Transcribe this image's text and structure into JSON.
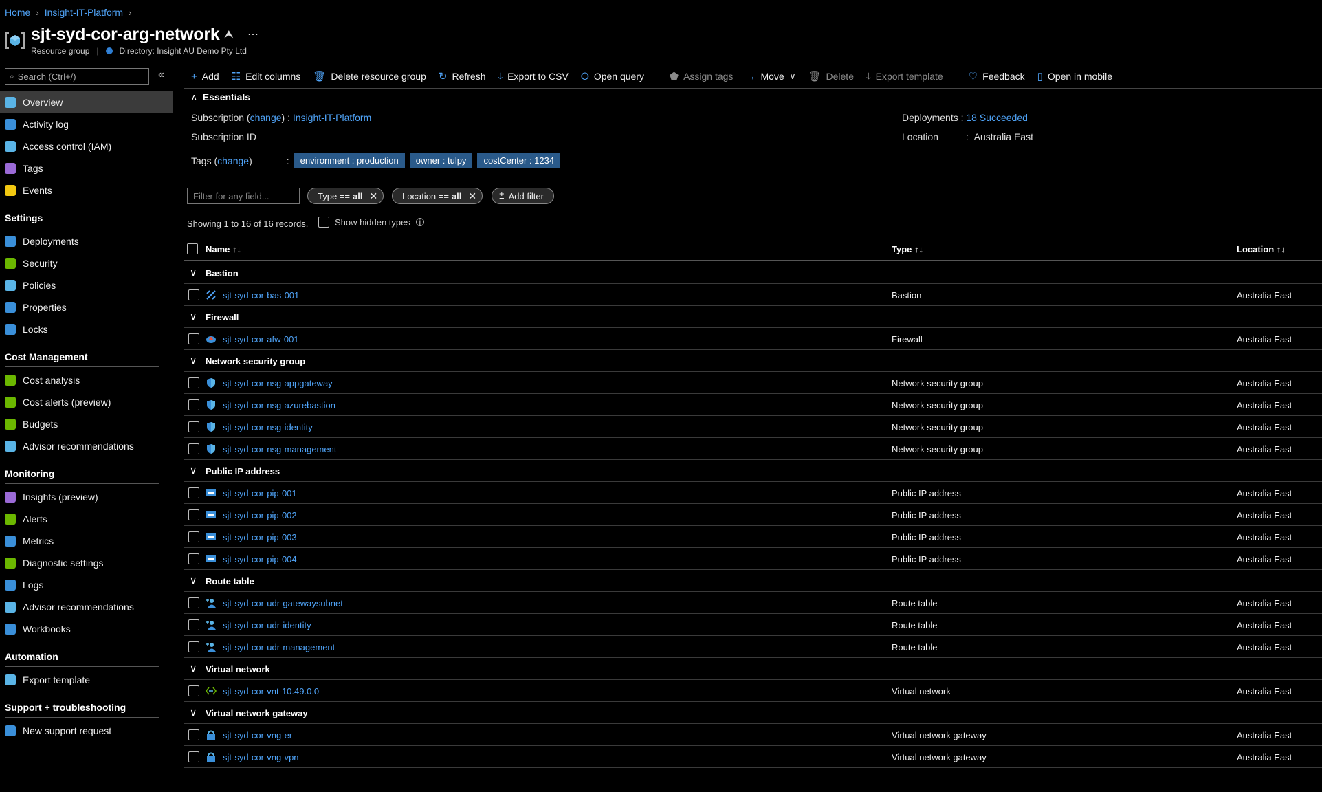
{
  "breadcrumb": {
    "home": "Home",
    "parent": "Insight-IT-Platform"
  },
  "header": {
    "title": "sjt-syd-cor-arg-network",
    "type": "Resource group",
    "directory": "Directory: Insight AU Demo Pty Ltd"
  },
  "search": {
    "placeholder": "Search (Ctrl+/)"
  },
  "sidebar": {
    "top": [
      {
        "label": "Overview",
        "icon": "overview-icon",
        "color": "#5ab4e6"
      },
      {
        "label": "Activity log",
        "icon": "activity-log-icon",
        "color": "#3a8fd9"
      },
      {
        "label": "Access control (IAM)",
        "icon": "iam-icon",
        "color": "#5ab4e6"
      },
      {
        "label": "Tags",
        "icon": "tag-icon",
        "color": "#9b6ad6"
      },
      {
        "label": "Events",
        "icon": "lightning-icon",
        "color": "#f2c811"
      }
    ],
    "sections": [
      {
        "title": "Settings",
        "items": [
          {
            "label": "Deployments",
            "icon": "deployments-icon",
            "color": "#3a8fd9"
          },
          {
            "label": "Security",
            "icon": "shield-icon",
            "color": "#6bb700"
          },
          {
            "label": "Policies",
            "icon": "policies-icon",
            "color": "#5ab4e6"
          },
          {
            "label": "Properties",
            "icon": "properties-icon",
            "color": "#3a8fd9"
          },
          {
            "label": "Locks",
            "icon": "lock-icon",
            "color": "#3a8fd9"
          }
        ]
      },
      {
        "title": "Cost Management",
        "items": [
          {
            "label": "Cost analysis",
            "icon": "cost-analysis-icon",
            "color": "#6bb700"
          },
          {
            "label": "Cost alerts (preview)",
            "icon": "cost-alerts-icon",
            "color": "#6bb700"
          },
          {
            "label": "Budgets",
            "icon": "budgets-icon",
            "color": "#6bb700"
          },
          {
            "label": "Advisor recommendations",
            "icon": "advisor-icon",
            "color": "#5ab4e6"
          }
        ]
      },
      {
        "title": "Monitoring",
        "items": [
          {
            "label": "Insights (preview)",
            "icon": "insights-icon",
            "color": "#9b6ad6"
          },
          {
            "label": "Alerts",
            "icon": "alerts-icon",
            "color": "#6bb700"
          },
          {
            "label": "Metrics",
            "icon": "metrics-icon",
            "color": "#3a8fd9"
          },
          {
            "label": "Diagnostic settings",
            "icon": "diagnostic-icon",
            "color": "#6bb700"
          },
          {
            "label": "Logs",
            "icon": "logs-icon",
            "color": "#3a8fd9"
          },
          {
            "label": "Advisor recommendations",
            "icon": "advisor-icon",
            "color": "#5ab4e6"
          },
          {
            "label": "Workbooks",
            "icon": "workbooks-icon",
            "color": "#3a8fd9"
          }
        ]
      },
      {
        "title": "Automation",
        "items": [
          {
            "label": "Export template",
            "icon": "export-template-icon",
            "color": "#5ab4e6"
          }
        ]
      },
      {
        "title": "Support + troubleshooting",
        "items": [
          {
            "label": "New support request",
            "icon": "support-icon",
            "color": "#3a8fd9"
          }
        ]
      }
    ]
  },
  "toolbar": {
    "add": "Add",
    "edit_columns": "Edit columns",
    "delete_rg": "Delete resource group",
    "refresh": "Refresh",
    "export_csv": "Export to CSV",
    "open_query": "Open query",
    "assign_tags": "Assign tags",
    "move": "Move",
    "delete": "Delete",
    "export_template": "Export template",
    "feedback": "Feedback",
    "open_mobile": "Open in mobile"
  },
  "essentials": {
    "heading": "Essentials",
    "subscription_label": "Subscription",
    "change": "change",
    "subscription_value": "Insight-IT-Platform",
    "subscription_id_label": "Subscription ID",
    "tags_label": "Tags",
    "tags": [
      "environment : production",
      "owner : tulpy",
      "costCenter : 1234"
    ],
    "deployments_label": "Deployments",
    "deployments_value": "18 Succeeded",
    "location_label": "Location",
    "location_value": "Australia East"
  },
  "filters": {
    "placeholder": "Filter for any field...",
    "type_pill": "Type ==",
    "location_pill": "Location ==",
    "all": "all",
    "add_filter": "Add filter"
  },
  "records": {
    "showing": "Showing 1 to 16 of 16 records.",
    "show_hidden": "Show hidden types"
  },
  "table": {
    "columns": {
      "name": "Name",
      "type": "Type",
      "location": "Location"
    },
    "groups": [
      {
        "name": "Bastion",
        "rows": [
          {
            "name": "sjt-syd-cor-bas-001",
            "type": "Bastion",
            "location": "Australia East",
            "icon": "bastion-icon"
          }
        ]
      },
      {
        "name": "Firewall",
        "rows": [
          {
            "name": "sjt-syd-cor-afw-001",
            "type": "Firewall",
            "location": "Australia East",
            "icon": "firewall-icon"
          }
        ]
      },
      {
        "name": "Network security group",
        "rows": [
          {
            "name": "sjt-syd-cor-nsg-appgateway",
            "type": "Network security group",
            "location": "Australia East",
            "icon": "nsg-shield-icon"
          },
          {
            "name": "sjt-syd-cor-nsg-azurebastion",
            "type": "Network security group",
            "location": "Australia East",
            "icon": "nsg-shield-icon"
          },
          {
            "name": "sjt-syd-cor-nsg-identity",
            "type": "Network security group",
            "location": "Australia East",
            "icon": "nsg-shield-icon"
          },
          {
            "name": "sjt-syd-cor-nsg-management",
            "type": "Network security group",
            "location": "Australia East",
            "icon": "nsg-shield-icon"
          }
        ]
      },
      {
        "name": "Public IP address",
        "rows": [
          {
            "name": "sjt-syd-cor-pip-001",
            "type": "Public IP address",
            "location": "Australia East",
            "icon": "public-ip-icon"
          },
          {
            "name": "sjt-syd-cor-pip-002",
            "type": "Public IP address",
            "location": "Australia East",
            "icon": "public-ip-icon"
          },
          {
            "name": "sjt-syd-cor-pip-003",
            "type": "Public IP address",
            "location": "Australia East",
            "icon": "public-ip-icon"
          },
          {
            "name": "sjt-syd-cor-pip-004",
            "type": "Public IP address",
            "location": "Australia East",
            "icon": "public-ip-icon"
          }
        ]
      },
      {
        "name": "Route table",
        "rows": [
          {
            "name": "sjt-syd-cor-udr-gatewaysubnet",
            "type": "Route table",
            "location": "Australia East",
            "icon": "route-table-icon"
          },
          {
            "name": "sjt-syd-cor-udr-identity",
            "type": "Route table",
            "location": "Australia East",
            "icon": "route-table-icon"
          },
          {
            "name": "sjt-syd-cor-udr-management",
            "type": "Route table",
            "location": "Australia East",
            "icon": "route-table-icon"
          }
        ]
      },
      {
        "name": "Virtual network",
        "rows": [
          {
            "name": "sjt-syd-cor-vnt-10.49.0.0",
            "type": "Virtual network",
            "location": "Australia East",
            "icon": "vnet-icon"
          }
        ]
      },
      {
        "name": "Virtual network gateway",
        "rows": [
          {
            "name": "sjt-syd-cor-vng-er",
            "type": "Virtual network gateway",
            "location": "Australia East",
            "icon": "vnet-gateway-icon"
          },
          {
            "name": "sjt-syd-cor-vng-vpn",
            "type": "Virtual network gateway",
            "location": "Australia East",
            "icon": "vnet-gateway-icon"
          }
        ]
      }
    ]
  }
}
